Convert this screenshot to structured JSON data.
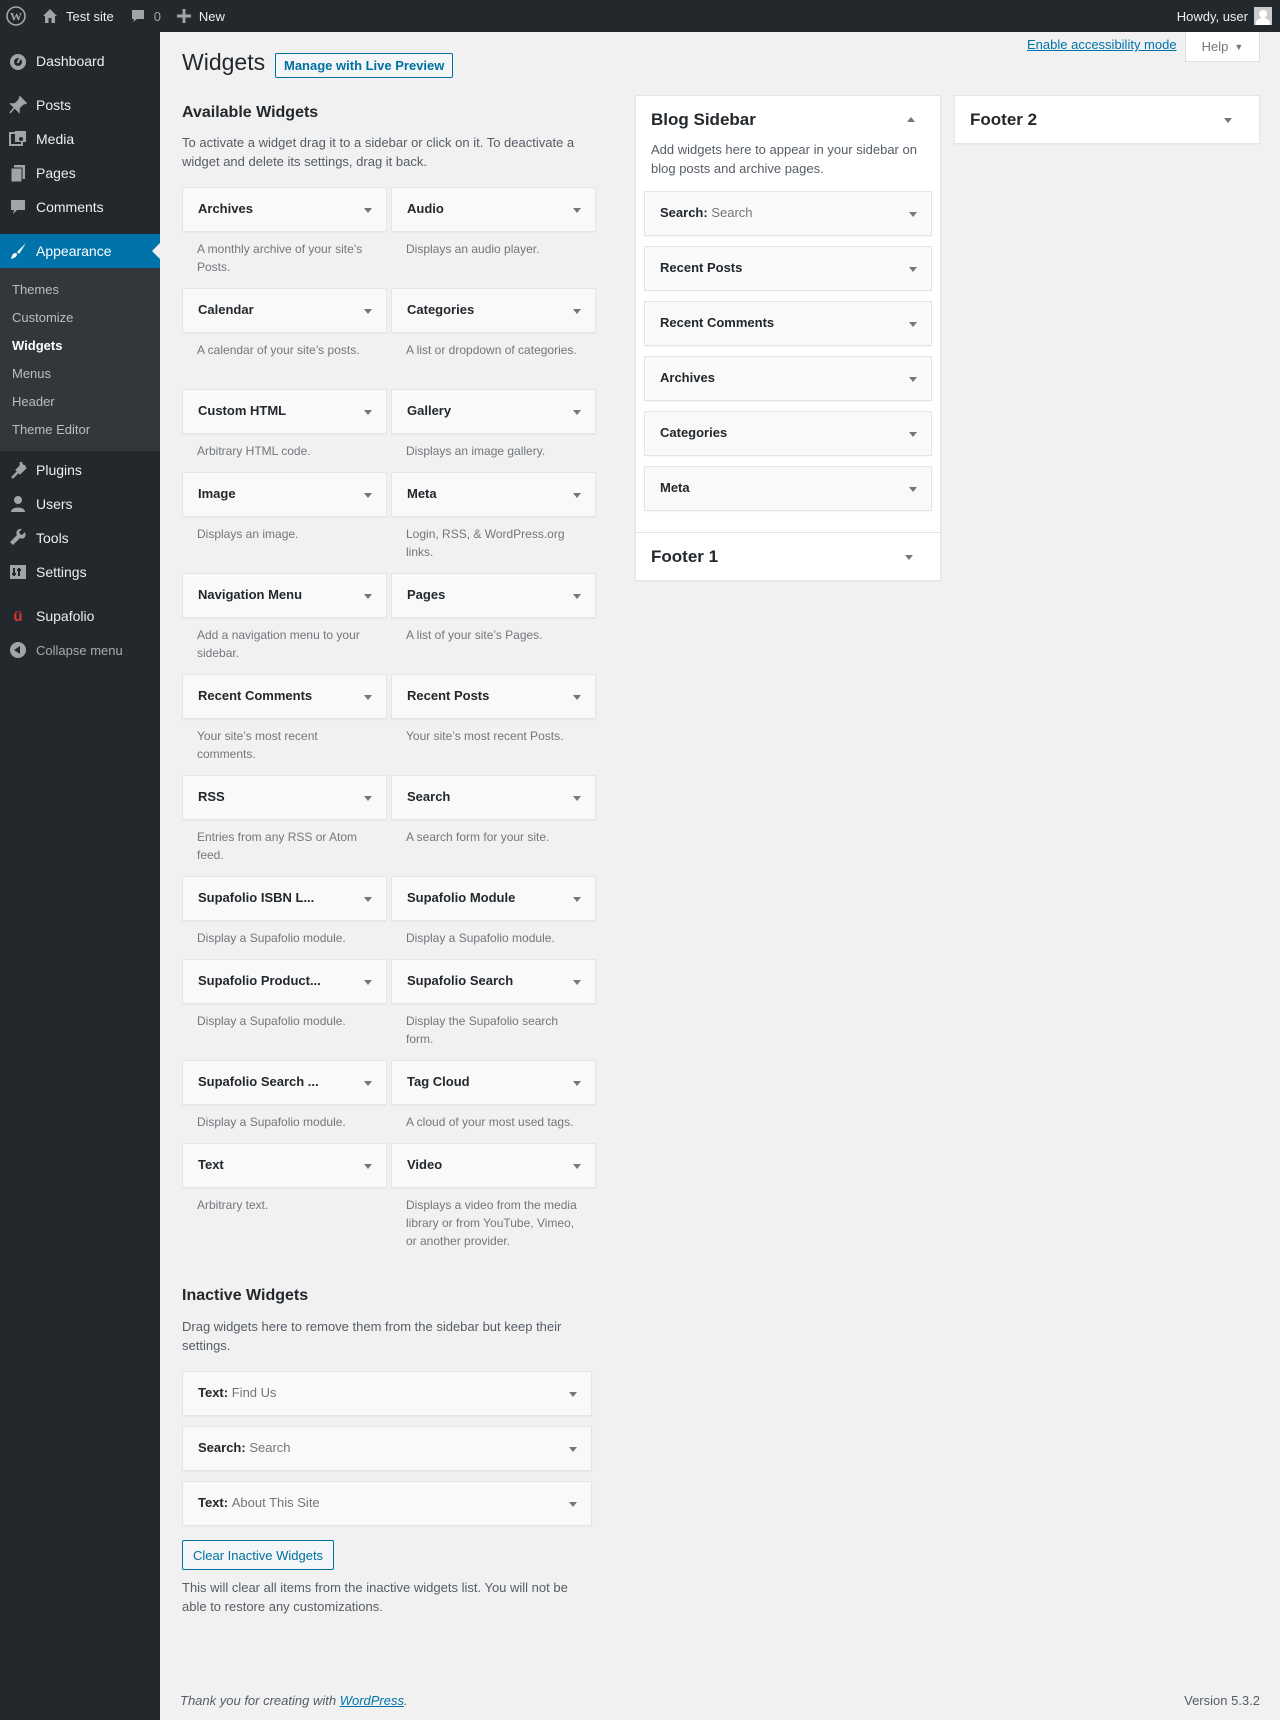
{
  "adminbar": {
    "site_name": "Test site",
    "comments_count": "0",
    "new_label": "New",
    "howdy": "Howdy, user"
  },
  "menu": {
    "items_top": [
      {
        "label": "Dashboard",
        "icon": "dashboard-icon"
      }
    ],
    "items_mid": [
      {
        "label": "Posts",
        "icon": "pin-icon"
      },
      {
        "label": "Media",
        "icon": "media-icon"
      },
      {
        "label": "Pages",
        "icon": "pages-icon"
      },
      {
        "label": "Comments",
        "icon": "comment-icon"
      }
    ],
    "appearance": "Appearance",
    "submenu": [
      "Themes",
      "Customize",
      "Widgets",
      "Menus",
      "Header",
      "Theme Editor"
    ],
    "items_bottom": [
      {
        "label": "Plugins",
        "icon": "plugin-icon"
      },
      {
        "label": "Users",
        "icon": "users-icon"
      },
      {
        "label": "Tools",
        "icon": "wrench-icon"
      },
      {
        "label": "Settings",
        "icon": "settings-icon"
      }
    ],
    "supafolio": "Supafolio",
    "collapse": "Collapse menu"
  },
  "page": {
    "title": "Widgets",
    "live_preview": "Manage with Live Preview",
    "a11y": "Enable accessibility mode",
    "help": "Help"
  },
  "available": {
    "title": "Available Widgets",
    "desc": "To activate a widget drag it to a sidebar or click on it. To deactivate a widget and delete its settings, drag it back.",
    "widgets": [
      {
        "title": "Archives",
        "desc": "A monthly archive of your site’s Posts."
      },
      {
        "title": "Audio",
        "desc": "Displays an audio player."
      },
      {
        "title": "Calendar",
        "desc": "A calendar of your site’s posts."
      },
      {
        "title": "Categories",
        "desc": "A list or dropdown of categories."
      },
      {
        "title": "Custom HTML",
        "desc": "Arbitrary HTML code."
      },
      {
        "title": "Gallery",
        "desc": "Displays an image gallery."
      },
      {
        "title": "Image",
        "desc": "Displays an image."
      },
      {
        "title": "Meta",
        "desc": "Login, RSS, & WordPress.org links."
      },
      {
        "title": "Navigation Menu",
        "desc": "Add a navigation menu to your sidebar."
      },
      {
        "title": "Pages",
        "desc": "A list of your site’s Pages."
      },
      {
        "title": "Recent Comments",
        "desc": "Your site’s most recent comments."
      },
      {
        "title": "Recent Posts",
        "desc": "Your site’s most recent Posts."
      },
      {
        "title": "RSS",
        "desc": "Entries from any RSS or Atom feed."
      },
      {
        "title": "Search",
        "desc": "A search form for your site."
      },
      {
        "title": "Supafolio ISBN L...",
        "desc": "Display a Supafolio module."
      },
      {
        "title": "Supafolio Module",
        "desc": "Display a Supafolio module."
      },
      {
        "title": "Supafolio Product...",
        "desc": "Display a Supafolio module."
      },
      {
        "title": "Supafolio Search",
        "desc": "Display the Supafolio search form."
      },
      {
        "title": "Supafolio Search ...",
        "desc": "Display a Supafolio module."
      },
      {
        "title": "Tag Cloud",
        "desc": "A cloud of your most used tags."
      },
      {
        "title": "Text",
        "desc": "Arbitrary text."
      },
      {
        "title": "Video",
        "desc": "Displays a video from the media library or from YouTube, Vimeo, or another provider."
      }
    ]
  },
  "inactive": {
    "title": "Inactive Widgets",
    "desc": "Drag widgets here to remove them from the sidebar but keep their settings.",
    "widgets": [
      {
        "title": "Text:",
        "sub": "Find Us"
      },
      {
        "title": "Search:",
        "sub": "Search"
      },
      {
        "title": "Text:",
        "sub": "About This Site"
      }
    ],
    "clear_btn": "Clear Inactive Widgets",
    "clear_desc": "This will clear all items from the inactive widgets list. You will not be able to restore any customizations."
  },
  "blog_sidebar": {
    "title": "Blog Sidebar",
    "desc": "Add widgets here to appear in your sidebar on blog posts and archive pages.",
    "widgets": [
      {
        "title": "Search:",
        "sub": "Search"
      },
      {
        "title": "Recent Posts",
        "sub": ""
      },
      {
        "title": "Recent Comments",
        "sub": ""
      },
      {
        "title": "Archives",
        "sub": ""
      },
      {
        "title": "Categories",
        "sub": ""
      },
      {
        "title": "Meta",
        "sub": ""
      }
    ]
  },
  "footer1": {
    "title": "Footer 1"
  },
  "footer2": {
    "title": "Footer 2"
  },
  "footer": {
    "thanks_pre": "Thank you for creating with",
    "link": "WordPress",
    "thanks_post": ".",
    "version": "Version 5.3.2"
  },
  "colors": {
    "accent": "#0073aa",
    "sidebar_bg": "#23282d",
    "submenu_bg": "#32373c",
    "page_bg": "#f1f1f1"
  }
}
